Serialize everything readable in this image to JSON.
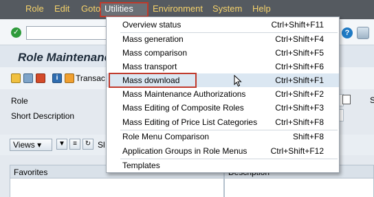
{
  "menubar": {
    "items": [
      {
        "label": "Role"
      },
      {
        "label": "Edit"
      },
      {
        "label": "Goto"
      },
      {
        "label": "Utilities"
      },
      {
        "label": "Environment"
      },
      {
        "label": "System"
      },
      {
        "label": "Help"
      }
    ]
  },
  "page": {
    "title": "Role Maintenance",
    "transaction_label": "Transac"
  },
  "form": {
    "role_label": "Role",
    "short_description_label": "Short Description",
    "side_letter": "S"
  },
  "views": {
    "label": "Views",
    "extra_letter": "Sl"
  },
  "tables": {
    "favorites_header": "Favorites",
    "description_header": "Description"
  },
  "dropdown": {
    "items": [
      {
        "label": "Overview status",
        "shortcut": "Ctrl+Shift+F11"
      },
      {
        "label": "Mass generation",
        "shortcut": "Ctrl+Shift+F4"
      },
      {
        "label": "Mass comparison",
        "shortcut": "Ctrl+Shift+F5"
      },
      {
        "label": "Mass transport",
        "shortcut": "Ctrl+Shift+F6"
      },
      {
        "label": "Mass download",
        "shortcut": "Ctrl+Shift+F1"
      },
      {
        "label": "Mass Maintenance Authorizations",
        "shortcut": "Ctrl+Shift+F2"
      },
      {
        "label": "Mass Editing of Composite Roles",
        "shortcut": "Ctrl+Shift+F3"
      },
      {
        "label": "Mass Editing of Price List Categories",
        "shortcut": "Ctrl+Shift+F8"
      },
      {
        "label": "Role Menu Comparison",
        "shortcut": "Shift+F8"
      },
      {
        "label": "Application Groups in Role Menus",
        "shortcut": "Ctrl+Shift+F12"
      },
      {
        "label": "Templates",
        "shortcut": ""
      }
    ]
  },
  "colors": {
    "menubar_bg": "#555a60",
    "menu_text": "#f5d26b",
    "highlight_border": "#c0392b",
    "hover_bg": "#dbe7f2"
  }
}
